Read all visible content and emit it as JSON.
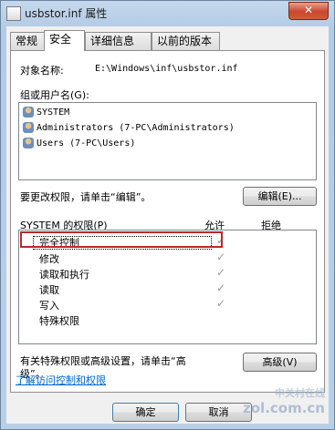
{
  "window": {
    "title": "usbstor.inf 属性",
    "close_label": "✕"
  },
  "tabs": [
    {
      "label": "常规"
    },
    {
      "label": "安全"
    },
    {
      "label": "详细信息"
    },
    {
      "label": "以前的版本"
    }
  ],
  "object": {
    "label": "对象名称:",
    "value": "E:\\Windows\\inf\\usbstor.inf"
  },
  "users": {
    "heading": "组或用户名(G):",
    "items": [
      {
        "name": "SYSTEM"
      },
      {
        "name": "Administrators (7-PC\\Administrators)"
      },
      {
        "name": "Users (7-PC\\Users)"
      }
    ]
  },
  "edit": {
    "hint": "要更改权限，请单击“编辑”。",
    "button_label": "编辑(E)..."
  },
  "permissions": {
    "heading": "SYSTEM 的权限(P)",
    "allow_header": "允许",
    "deny_header": "拒绝",
    "check_glyph": "✓",
    "items": [
      {
        "name": "完全控制",
        "allow": true
      },
      {
        "name": "修改",
        "allow": true
      },
      {
        "name": "读取和执行",
        "allow": true
      },
      {
        "name": "读取",
        "allow": true
      },
      {
        "name": "写入",
        "allow": true
      },
      {
        "name": "特殊权限",
        "allow": false
      }
    ]
  },
  "advanced": {
    "hint_line1": "有关特殊权限或高级设置，请单击“高",
    "hint_line2": "级”。",
    "button_label": "高级(V)"
  },
  "link": {
    "label": "了解访问控制和权限"
  },
  "footer": {
    "ok_label": "确定",
    "cancel_label": "取消"
  },
  "watermark": {
    "line1": "中关村在线",
    "line2": "zol.com.cn"
  }
}
